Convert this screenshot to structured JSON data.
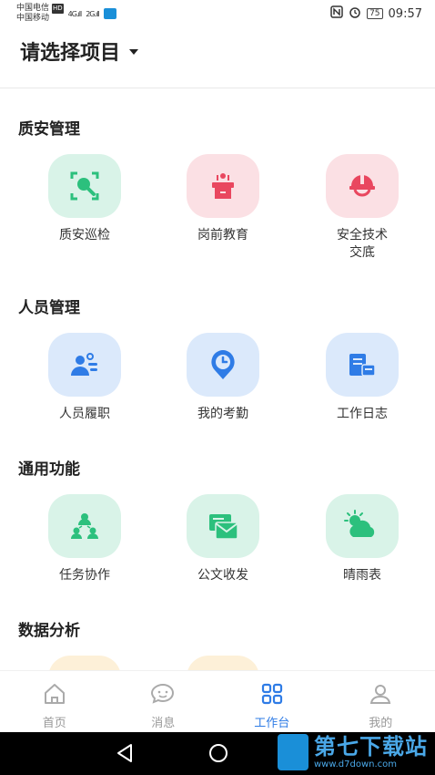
{
  "status_bar": {
    "carrier1": "中国电信",
    "carrier2": "中国移动",
    "hd": "HD",
    "signal1": "4G",
    "signal2": "2G",
    "battery": "75",
    "time": "09:57"
  },
  "header": {
    "title": "请选择项目"
  },
  "sections": [
    {
      "title": "质安管理",
      "items": [
        {
          "label": "质安巡检",
          "icon": "search-inspect-icon"
        },
        {
          "label": "岗前教育",
          "icon": "podium-icon"
        },
        {
          "label": "安全技术交底",
          "label_line1": "安全技术",
          "label_line2": "交底",
          "icon": "hard-hat-icon"
        }
      ]
    },
    {
      "title": "人员管理",
      "items": [
        {
          "label": "人员履职",
          "icon": "person-duty-icon"
        },
        {
          "label": "我的考勤",
          "icon": "clock-pin-icon"
        },
        {
          "label": "工作日志",
          "icon": "work-log-icon"
        }
      ]
    },
    {
      "title": "通用功能",
      "items": [
        {
          "label": "任务协作",
          "icon": "team-collab-icon"
        },
        {
          "label": "公文收发",
          "icon": "mail-doc-icon"
        },
        {
          "label": "晴雨表",
          "icon": "weather-icon"
        }
      ]
    },
    {
      "title": "数据分析",
      "items": []
    }
  ],
  "tabbar": [
    {
      "label": "首页",
      "icon": "home-icon",
      "active": false
    },
    {
      "label": "消息",
      "icon": "chat-icon",
      "active": false
    },
    {
      "label": "工作台",
      "icon": "grid-icon",
      "active": true
    },
    {
      "label": "我的",
      "icon": "user-icon",
      "active": false
    }
  ],
  "watermark": {
    "title": "第七下载站",
    "url": "www.d7down.com"
  },
  "colors": {
    "accent": "#2f7ce6",
    "green_icon": "#2cc07d",
    "pink_icon": "#e9475f",
    "blue_icon": "#2f7ce6"
  }
}
